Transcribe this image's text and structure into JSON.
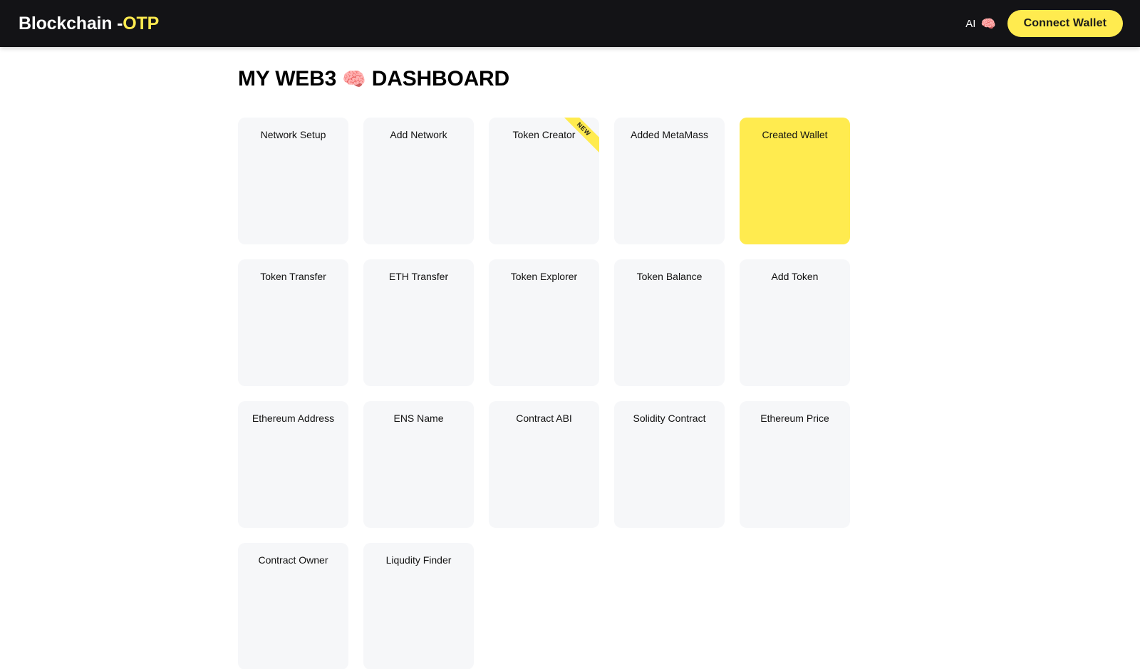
{
  "header": {
    "brand_main": "Blockchain -",
    "brand_accent": "OTP",
    "ai_label": "AI",
    "ai_icon": "brain-emoji",
    "ai_emoji": "🧠",
    "connect_wallet_label": "Connect Wallet"
  },
  "main": {
    "title_prefix": "MY WEB3",
    "title_emoji": "🧠",
    "title_suffix": "DASHBOARD",
    "cards": [
      {
        "label": "Network Setup",
        "highlighted": false,
        "badge": null
      },
      {
        "label": "Add Network",
        "highlighted": false,
        "badge": null
      },
      {
        "label": "Token Creator",
        "highlighted": false,
        "badge": "NEW"
      },
      {
        "label": "Added MetaMass",
        "highlighted": false,
        "badge": null
      },
      {
        "label": "Created Wallet",
        "highlighted": true,
        "badge": null
      },
      {
        "label": "Token Transfer",
        "highlighted": false,
        "badge": null
      },
      {
        "label": "ETH Transfer",
        "highlighted": false,
        "badge": null
      },
      {
        "label": "Token Explorer",
        "highlighted": false,
        "badge": null
      },
      {
        "label": "Token Balance",
        "highlighted": false,
        "badge": null
      },
      {
        "label": "Add Token",
        "highlighted": false,
        "badge": null
      },
      {
        "label": "Ethereum Address",
        "highlighted": false,
        "badge": null
      },
      {
        "label": "ENS Name",
        "highlighted": false,
        "badge": null
      },
      {
        "label": "Contract ABI",
        "highlighted": false,
        "badge": null
      },
      {
        "label": "Solidity Contract",
        "highlighted": false,
        "badge": null
      },
      {
        "label": "Ethereum Price",
        "highlighted": false,
        "badge": null
      },
      {
        "label": "Contract Owner",
        "highlighted": false,
        "badge": null
      },
      {
        "label": "Liqudity Finder",
        "highlighted": false,
        "badge": null
      }
    ]
  },
  "colors": {
    "header_bg": "#131316",
    "accent_yellow": "#ffeb4f",
    "card_bg": "#f6f7f9",
    "page_bg": "#ffffff",
    "text_dark": "#111111"
  }
}
